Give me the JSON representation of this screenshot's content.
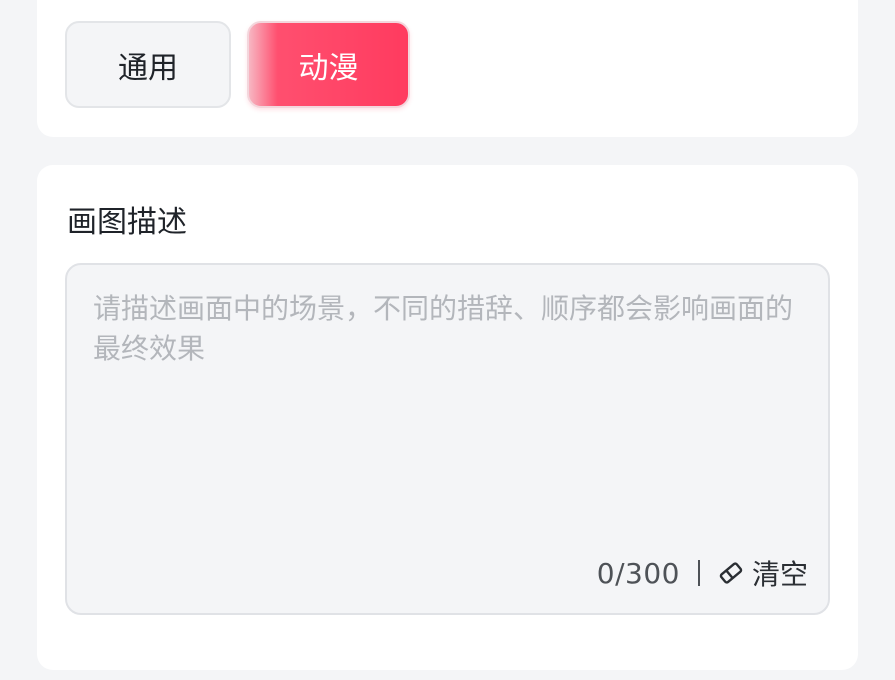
{
  "style_selector": {
    "options": [
      {
        "label": "通用",
        "selected": false
      },
      {
        "label": "动漫",
        "selected": true
      }
    ],
    "accent_color": "#ff3b5f"
  },
  "description": {
    "title": "画图描述",
    "value": "",
    "placeholder": "请描述画面中的场景，不同的措辞、顺序都会影响画面的最终效果",
    "counter": "0/300",
    "clear_label": "清空",
    "clear_icon": "eraser-icon"
  }
}
